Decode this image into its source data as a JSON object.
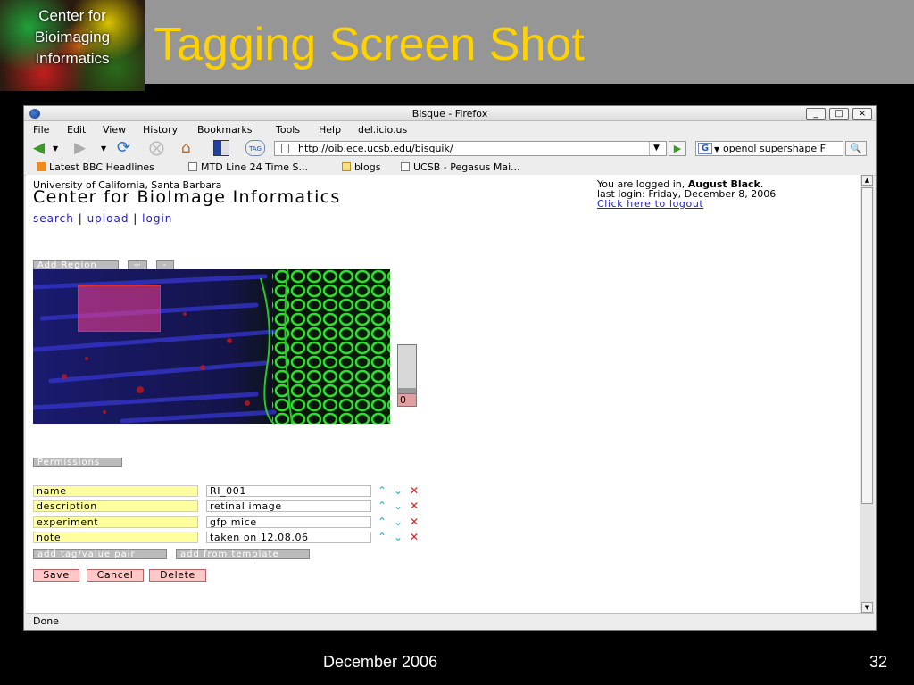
{
  "slide": {
    "logo_lines": [
      "Center for",
      "Bioimaging",
      "Informatics"
    ],
    "title": "Tagging Screen Shot",
    "footer_date": "December 2006",
    "page_number": "32"
  },
  "browser": {
    "window_title": "Bisque - Firefox",
    "window_buttons": [
      "_",
      "□",
      "×"
    ],
    "menu": [
      "File",
      "Edit",
      "View",
      "History",
      "Bookmarks",
      "Tools",
      "Help",
      "del.icio.us"
    ],
    "nav_icons": [
      "back-icon",
      "forward-icon",
      "reload-icon",
      "stop-icon",
      "home-icon",
      "screen-icon",
      "tag-icon"
    ],
    "url": "http://oib.ece.ucsb.edu/bisquik/",
    "search_engine": "G",
    "search_text": "opengl supershape F",
    "bookmarks": [
      {
        "label": "Latest BBC Headlines",
        "icon": "rss-icon"
      },
      {
        "label": "MTD Line 24 Time S...",
        "icon": "page-icon"
      },
      {
        "label": "blogs",
        "icon": "folder-icon"
      },
      {
        "label": "UCSB - Pegasus Mai...",
        "icon": "page-icon"
      }
    ],
    "status": "Done"
  },
  "page": {
    "university": "University of California, Santa Barbara",
    "site_title": "Center for BioImage Informatics",
    "nav": {
      "search": "search",
      "upload": "upload",
      "login": "login",
      "sep": "|"
    },
    "login_prefix": "You are logged in, ",
    "login_user": "August Black",
    "login_suffix": ".",
    "last_login": "last login: Friday, December 8, 2006",
    "logout": "Click here to logout",
    "add_region": "Add Region",
    "zoom_in": "+",
    "zoom_out": "-",
    "slider_value": "0",
    "permissions": "Permissions",
    "tags": [
      {
        "name": "name",
        "value": "RI_001"
      },
      {
        "name": "description",
        "value": "retinal image"
      },
      {
        "name": "experiment",
        "value": "gfp mice"
      },
      {
        "name": "note",
        "value": "taken on 12.08.06"
      }
    ],
    "add_pair": "add tag/value pair",
    "add_template": "add from template",
    "save": "Save",
    "cancel": "Cancel",
    "delete": "Delete"
  }
}
